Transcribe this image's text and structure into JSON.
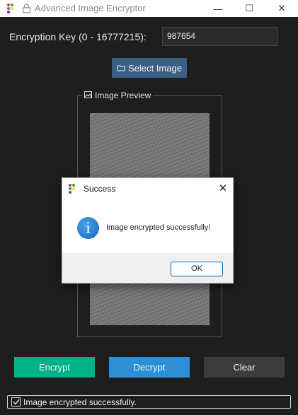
{
  "window": {
    "title": "Advanced Image Encryptor",
    "minimize_glyph": "—",
    "maximize_glyph": "☐",
    "close_glyph": "✕"
  },
  "key": {
    "label": "Encryption Key (0 - 16777215):",
    "value": "987654"
  },
  "select_button": {
    "label": "Select Image",
    "icon": "folder-icon"
  },
  "preview": {
    "label": "Image Preview",
    "icon": "image-icon"
  },
  "dialog": {
    "title": "Success",
    "message": "Image encrypted successfully!",
    "icon": "info-icon",
    "ok_label": "OK",
    "close_glyph": "✕"
  },
  "actions": {
    "encrypt_label": "Encrypt",
    "decrypt_label": "Decrypt",
    "clear_label": "Clear"
  },
  "status": {
    "text": "Image encrypted successfully.",
    "checked": true
  },
  "colors": {
    "background": "#1e1e1e",
    "encrypt": "#00b386",
    "decrypt": "#2e8fd6",
    "clear": "#3c3c3c",
    "select": "#3b5f86"
  }
}
